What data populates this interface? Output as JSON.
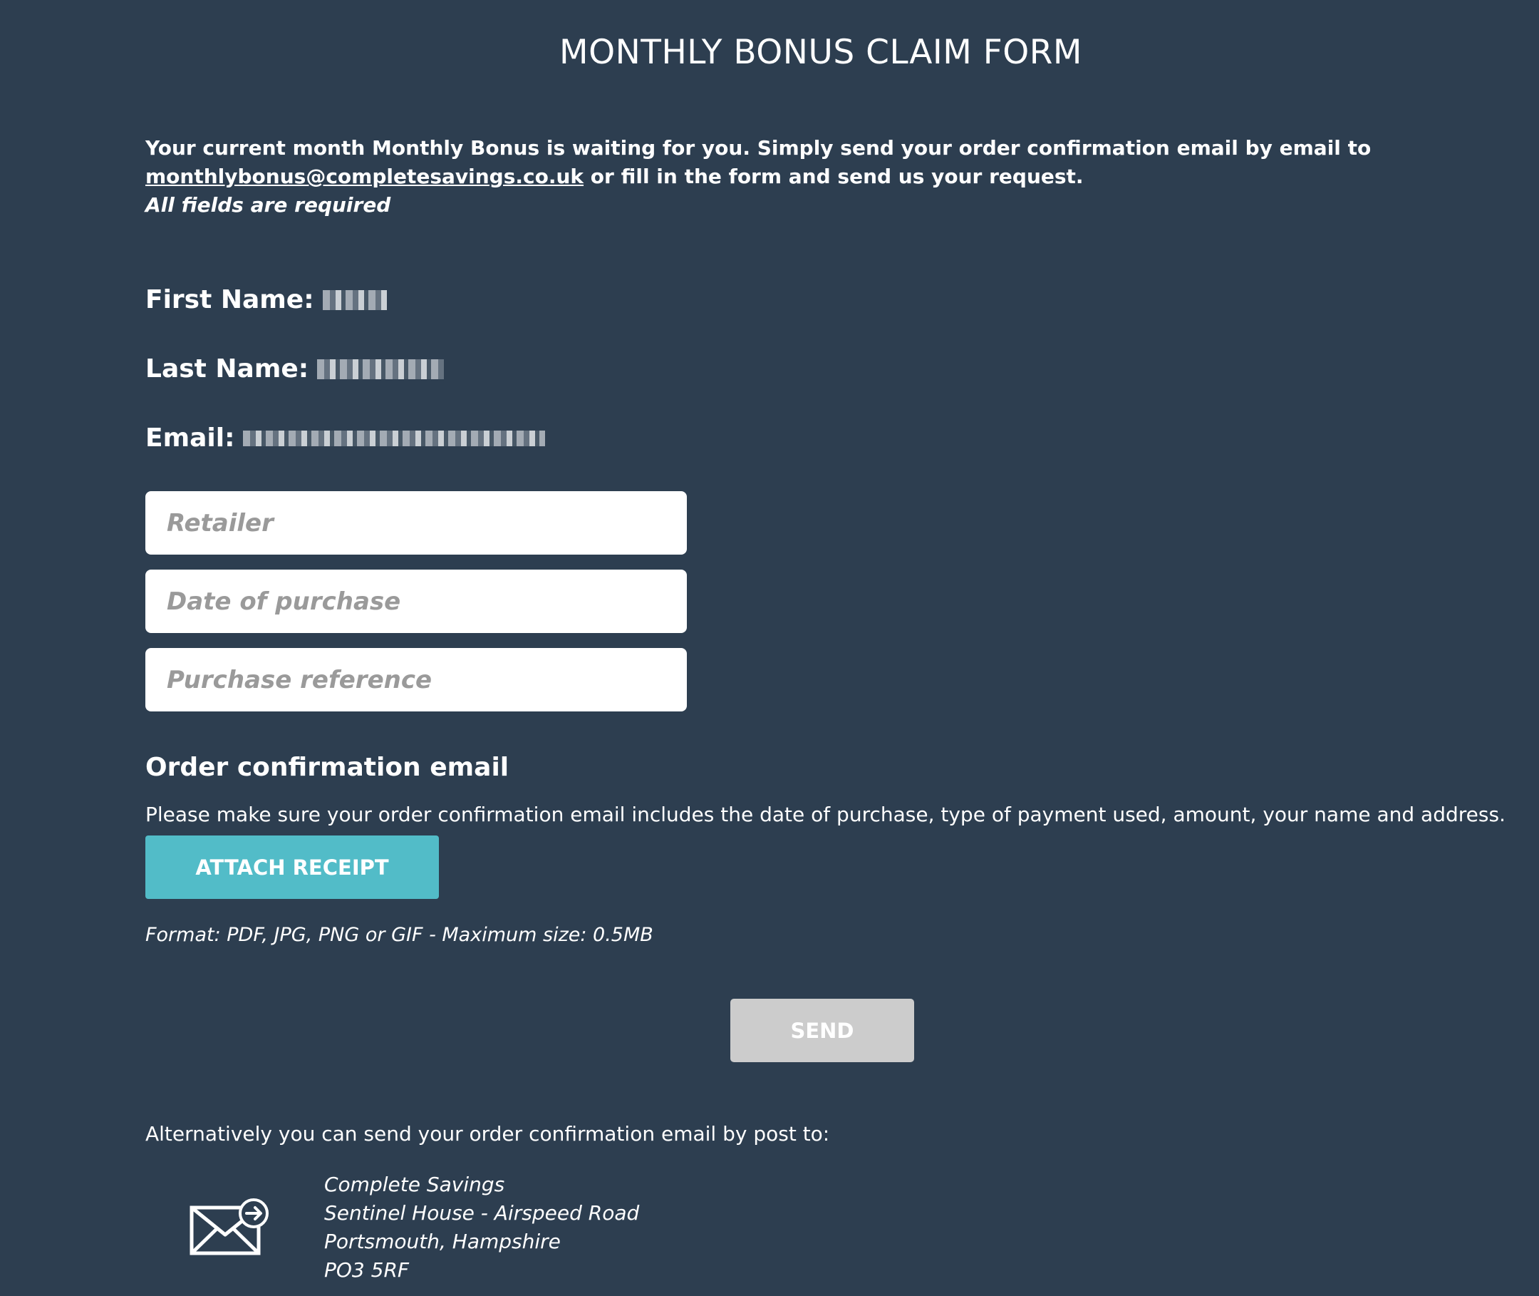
{
  "page": {
    "title": "MONTHLY BONUS CLAIM FORM"
  },
  "intro": {
    "text_before": "Your current month Monthly Bonus is waiting for you. Simply send your order confirmation email by email to ",
    "email_link": "monthlybonus@completesavings.co.uk",
    "text_after": " or fill in the form and send us your request.",
    "required_note": "All fields are required"
  },
  "profile": {
    "first_name_label": "First Name:",
    "last_name_label": "Last Name:",
    "email_label": "Email:"
  },
  "form": {
    "retailer_placeholder": "Retailer",
    "date_placeholder": "Date of purchase",
    "reference_placeholder": "Purchase reference"
  },
  "order_confirmation": {
    "heading": "Order confirmation email",
    "description": "Please make sure your order confirmation email includes the date of purchase, type of payment used, amount, your name and address.",
    "attach_label": "ATTACH RECEIPT",
    "format_note": "Format: PDF, JPG, PNG or GIF - Maximum size: 0.5MB"
  },
  "actions": {
    "send_label": "SEND"
  },
  "postal": {
    "intro": "Alternatively you can send your order confirmation email by post to:",
    "icon": "mail-send-icon",
    "address_lines": [
      "Complete Savings",
      "Sentinel House - Airspeed Road",
      "Portsmouth, Hampshire",
      "PO3 5RF"
    ]
  },
  "colors": {
    "background": "#2d3e50",
    "attach_button": "#52bcc8",
    "send_button_disabled": "#cccccc"
  }
}
